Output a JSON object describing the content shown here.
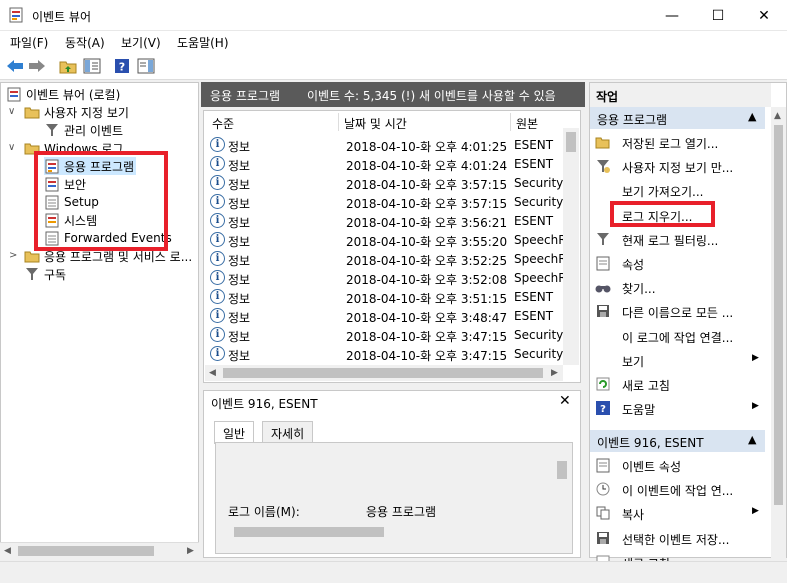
{
  "window": {
    "title": "이벤트 뷰어",
    "minimize": "—",
    "maximize": "☐",
    "close": "✕"
  },
  "menu": {
    "file": "파일(F)",
    "action": "동작(A)",
    "view": "보기(V)",
    "help": "도움말(H)"
  },
  "tree": {
    "root": "이벤트 뷰어 (로컬)",
    "custom_views": "사용자 지정 보기",
    "admin_events": "관리 이벤트",
    "windows_logs": "Windows 로그",
    "application": "응용 프로그램",
    "security": "보안",
    "setup": "Setup",
    "system": "시스템",
    "forwarded": "Forwarded Events",
    "apps_services": "응용 프로그램 및 서비스 로...",
    "subscriptions": "구독"
  },
  "middle": {
    "header_title": "응용 프로그램",
    "header_info": "이벤트 수: 5,345 (!) 새 이벤트를 사용할 수 있음",
    "columns": {
      "level": "수준",
      "date": "날짜 및 시간",
      "source": "원본"
    },
    "rows": [
      {
        "level": "정보",
        "date": "2018-04-10-화 오후 4:01:25",
        "source": "ESENT"
      },
      {
        "level": "정보",
        "date": "2018-04-10-화 오후 4:01:24",
        "source": "ESENT"
      },
      {
        "level": "정보",
        "date": "2018-04-10-화 오후 3:57:15",
        "source": "SecurityC"
      },
      {
        "level": "정보",
        "date": "2018-04-10-화 오후 3:57:15",
        "source": "SecurityC"
      },
      {
        "level": "정보",
        "date": "2018-04-10-화 오후 3:56:21",
        "source": "ESENT"
      },
      {
        "level": "정보",
        "date": "2018-04-10-화 오후 3:55:20",
        "source": "SpeechRu"
      },
      {
        "level": "정보",
        "date": "2018-04-10-화 오후 3:52:25",
        "source": "SpeechRu"
      },
      {
        "level": "정보",
        "date": "2018-04-10-화 오후 3:52:08",
        "source": "SpeechRu"
      },
      {
        "level": "정보",
        "date": "2018-04-10-화 오후 3:51:15",
        "source": "ESENT"
      },
      {
        "level": "정보",
        "date": "2018-04-10-화 오후 3:48:47",
        "source": "ESENT"
      },
      {
        "level": "정보",
        "date": "2018-04-10-화 오후 3:47:15",
        "source": "SecurityC"
      },
      {
        "level": "정보",
        "date": "2018-04-10-화 오후 3:47:15",
        "source": "SecurityC"
      }
    ],
    "detail_title": "이벤트 916, ESENT",
    "tab_general": "일반",
    "tab_details": "자세히",
    "log_name_label": "로그 이름(M):",
    "log_name_value": "응용 프로그램"
  },
  "actions": {
    "header": "작업",
    "section1": "응용 프로그램",
    "items1": [
      "저장된 로그 열기...",
      "사용자 지정 보기 만...",
      "보기 가져오기...",
      "로그 지우기...",
      "현재 로그 필터링...",
      "속성",
      "찾기...",
      "다른 이름으로 모든 ...",
      "이 로그에 작업 연결...",
      "보기",
      "새로 고침",
      "도움말"
    ],
    "section2": "이벤트 916, ESENT",
    "items2": [
      "이벤트 속성",
      "이 이벤트에 작업 연...",
      "복사",
      "선택한 이벤트 저장...",
      "새로 고침"
    ]
  },
  "colors": {
    "highlight_box": "#e8202a",
    "selection": "#cce8ff",
    "section_header": "#d9e4f1"
  }
}
